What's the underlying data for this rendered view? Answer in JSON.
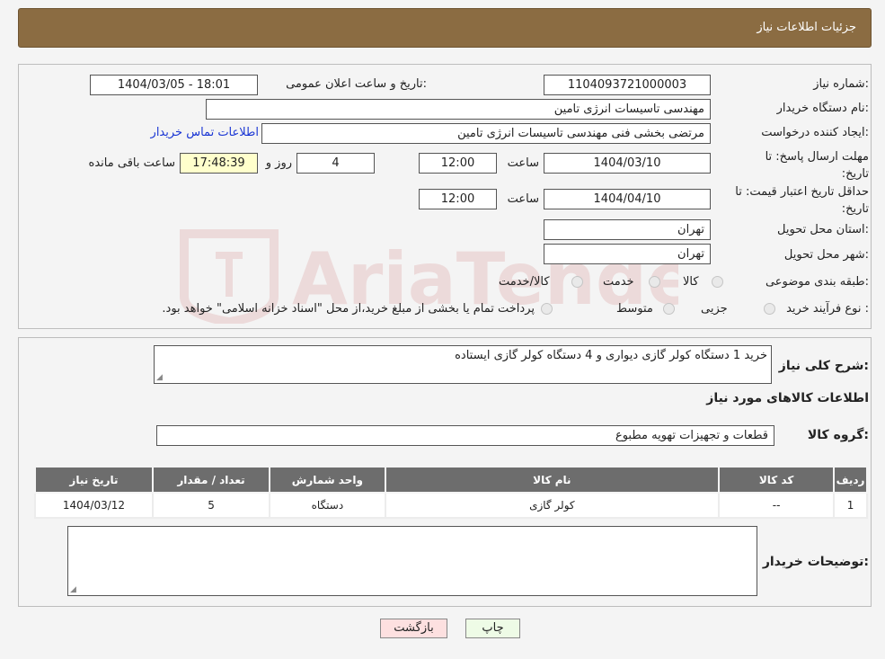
{
  "header": {
    "title": "جزئیات اطلاعات نیاز"
  },
  "watermark": {
    "text": "AriaTender.neT"
  },
  "form": {
    "need_number_label": "شماره نیاز:",
    "need_number": "1104093721000003",
    "announce_label": "تاریخ و ساعت اعلان عمومی:",
    "announce_value": "1404/03/05 - 18:01",
    "buyer_org_label": "نام دستگاه خریدار:",
    "buyer_org": "مهندسی تاسیسات انرژی تامین",
    "requester_label": "ایجاد کننده درخواست:",
    "requester": "مرتضی بخشی فنی مهندسی تاسیسات انرژی تامین",
    "contact_link": "اطلاعات تماس خریدار",
    "send_deadline_label": "مهلت ارسال پاسخ: تا تاریخ:",
    "send_date": "1404/03/10",
    "time_label": "ساعت",
    "send_time": "12:00",
    "days_value": "4",
    "days_label": "روز و",
    "remaining_value": "17:48:39",
    "remaining_label": "ساعت باقی مانده",
    "validity_label": "حداقل تاریخ اعتبار قیمت: تا تاریخ:",
    "validity_date": "1404/04/10",
    "validity_time": "12:00",
    "province_label": "استان محل تحویل:",
    "province": "تهران",
    "city_label": "شهر محل تحویل:",
    "city": "تهران",
    "category_label": "طبقه بندی موضوعی:",
    "category_options": [
      "کالا",
      "خدمت",
      "کالا/خدمت"
    ],
    "process_label": "نوع فرآیند خرید :",
    "process_options": [
      "جزیی",
      "متوسط"
    ],
    "process_note": "پرداخت تمام یا بخشی از مبلغ خرید،از محل \"اسناد خزانه اسلامی\" خواهد بود."
  },
  "details": {
    "summary_label": "شرح کلی نیاز:",
    "summary": "خرید 1 دستگاه کولر گازی دیواری و 4 دستگاه کولر گازی ایستاده",
    "goods_info_title": "اطلاعات کالاهای مورد نیاز",
    "goods_group_label": "گروه کالا:",
    "goods_group": "قطعات و تجهیزات تهویه مطبوع",
    "table": {
      "headers": [
        "ردیف",
        "کد کالا",
        "نام کالا",
        "واحد شمارش",
        "تعداد / مقدار",
        "تاریخ نیاز"
      ],
      "rows": [
        [
          "1",
          "--",
          "کولر گازی",
          "دستگاه",
          "5",
          "1404/03/12"
        ]
      ]
    },
    "buyer_notes_label": "توضیحات خریدار:",
    "buyer_notes": ""
  },
  "buttons": {
    "print": "چاپ",
    "back": "بازگشت"
  },
  "colors": {
    "header": "#8b6c42",
    "table_header": "#6d6d6d",
    "link": "#1a36d4"
  }
}
